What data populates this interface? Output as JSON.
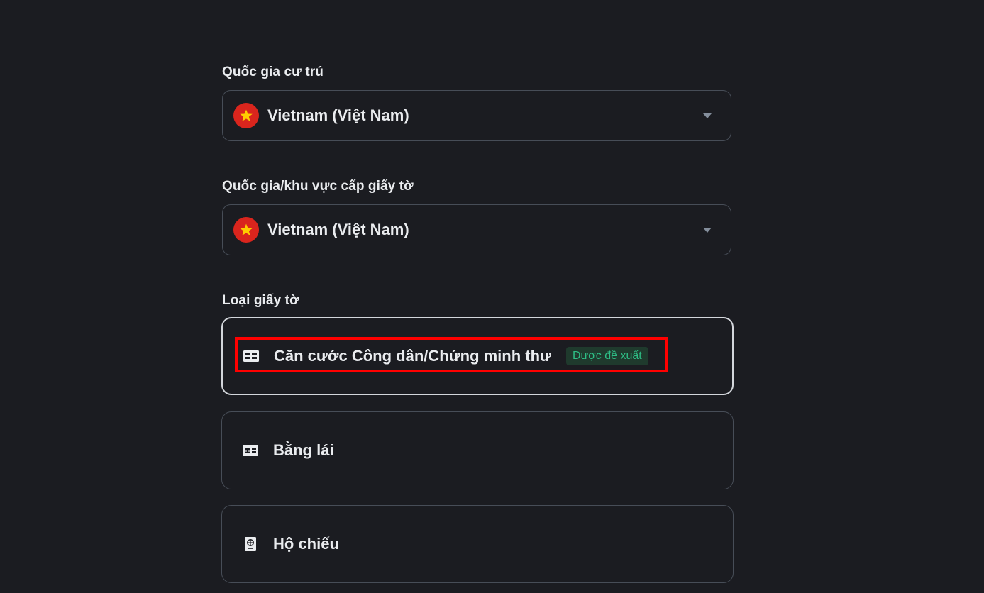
{
  "residence": {
    "label": "Quốc gia cư trú",
    "selected_value": "Vietnam (Việt Nam)",
    "flag_icon": "vietnam-flag-icon"
  },
  "issuing_country": {
    "label": "Quốc gia/khu vực cấp giấy tờ",
    "selected_value": "Vietnam (Việt Nam)",
    "flag_icon": "vietnam-flag-icon"
  },
  "document_type": {
    "label": "Loại giấy tờ",
    "options": [
      {
        "label": "Căn cước Công dân/Chứng minh thư",
        "badge": "Được đề xuất",
        "icon": "id-card-icon",
        "selected": true
      },
      {
        "label": "Bằng lái",
        "icon": "driver-license-icon",
        "selected": false
      },
      {
        "label": "Hộ chiếu",
        "icon": "passport-icon",
        "selected": false
      }
    ]
  },
  "colors": {
    "background": "#1b1c21",
    "border": "#474d57",
    "selected_border": "#d3d6db",
    "badge_text": "#2ebd85",
    "badge_bg": "#1f3a2d",
    "highlight": "#ff0000",
    "flag_red": "#da251d",
    "flag_star": "#ffcd00"
  }
}
